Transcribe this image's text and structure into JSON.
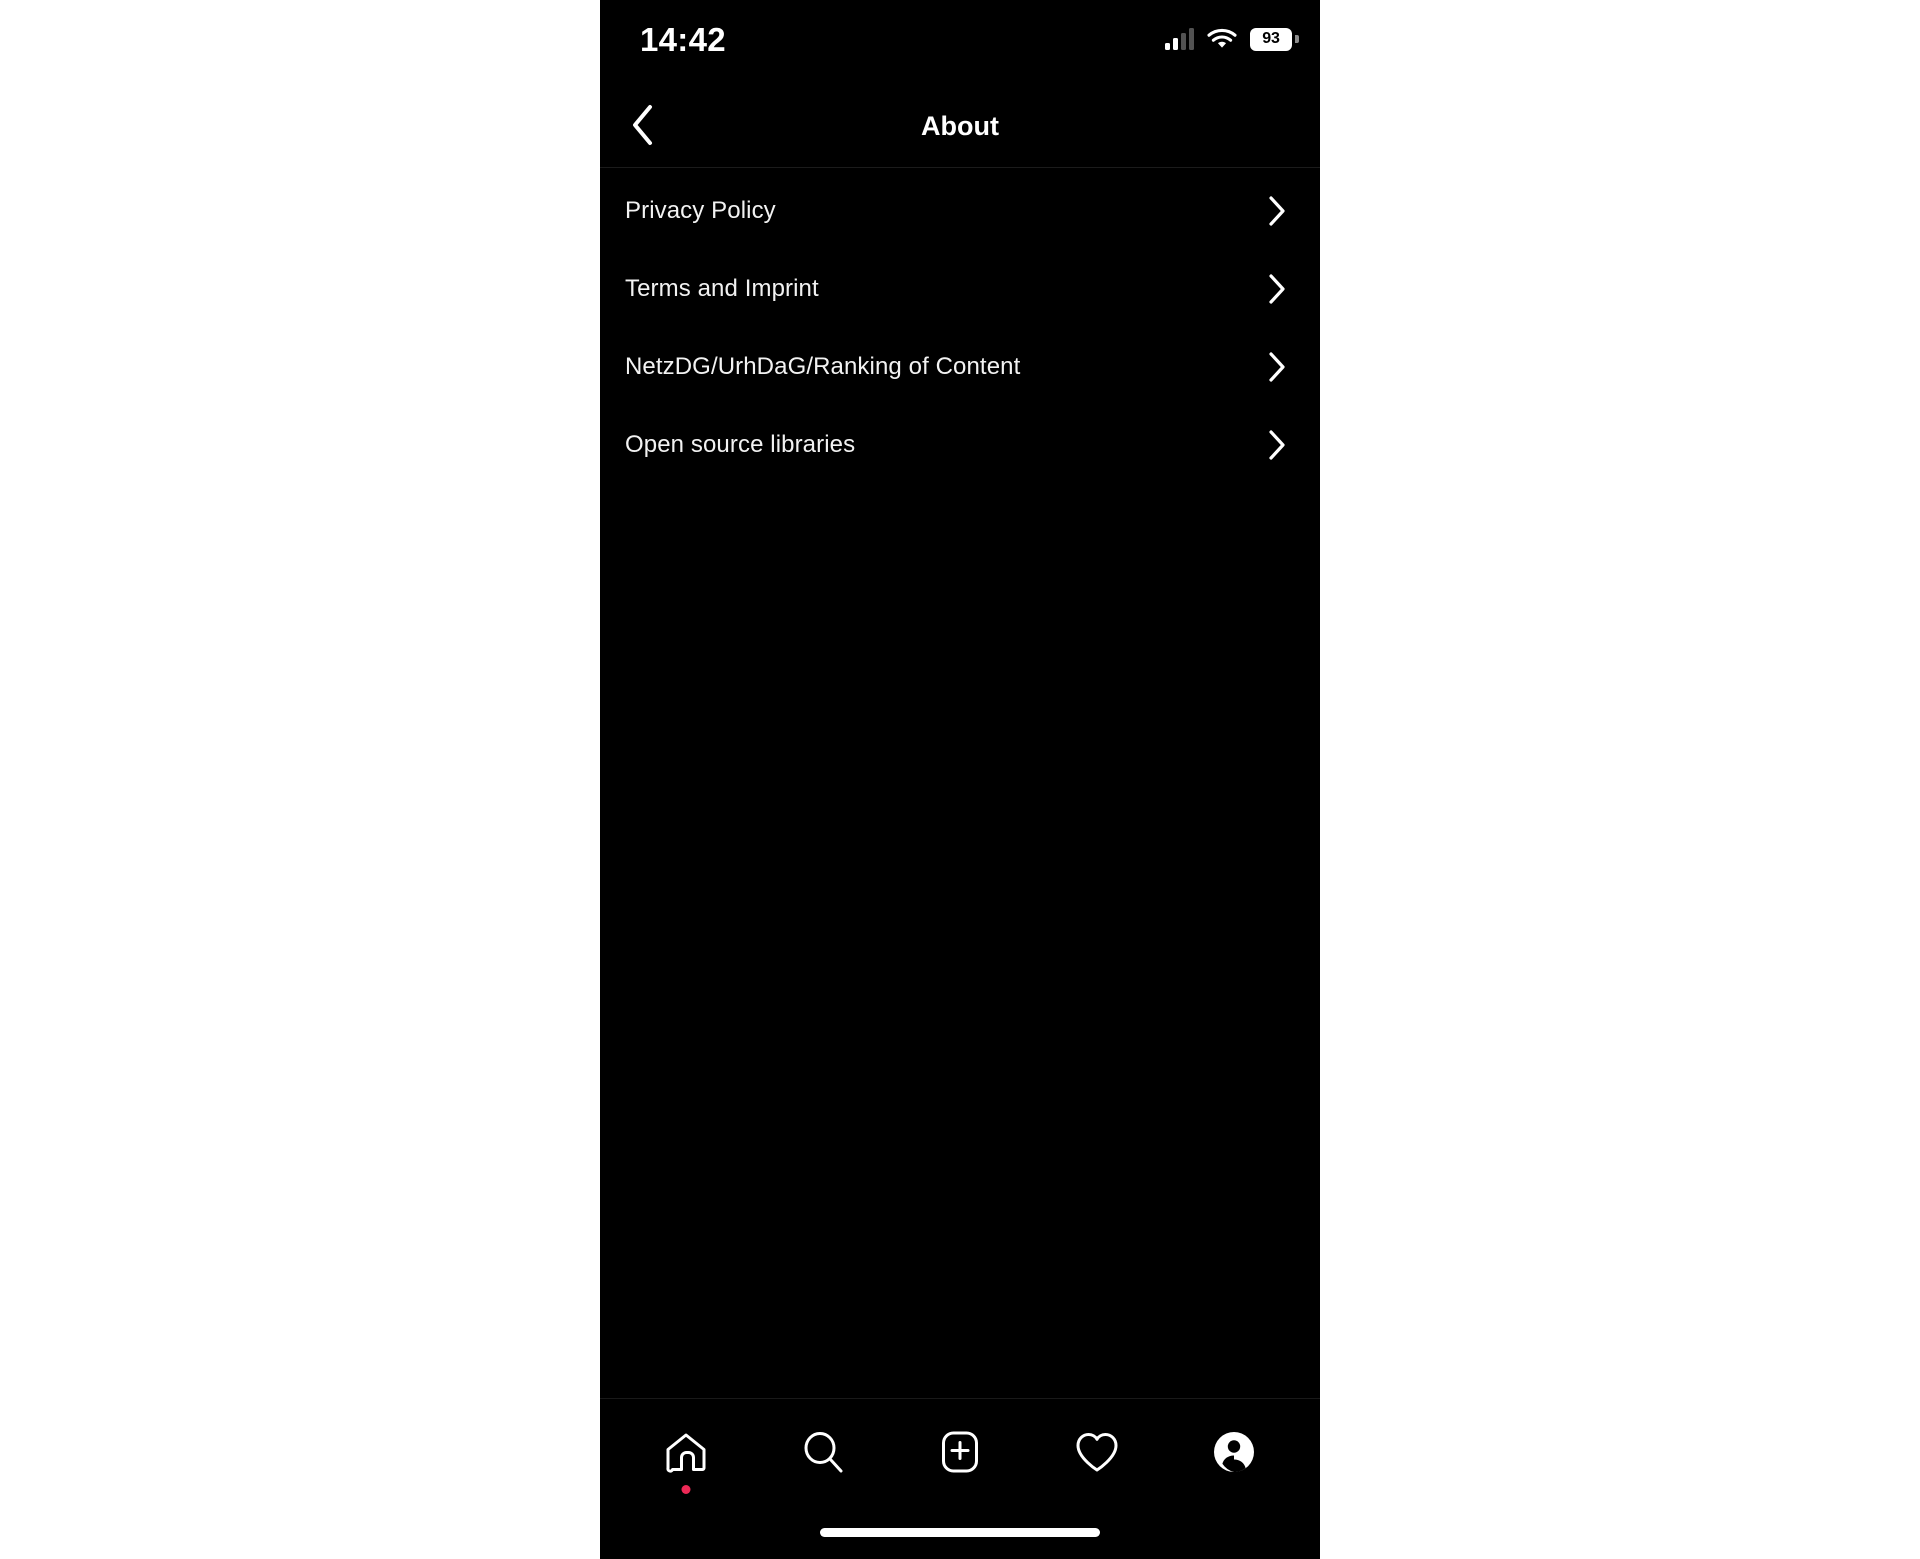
{
  "status_bar": {
    "time": "14:42",
    "battery_level": "93",
    "cellular_icon": "cellular-bars-icon",
    "wifi_icon": "wifi-icon",
    "battery_icon": "battery-icon"
  },
  "nav": {
    "title": "About",
    "back_icon": "chevron-left-icon"
  },
  "list": {
    "rows": [
      {
        "label": "Privacy Policy",
        "chevron": "chevron-right-icon"
      },
      {
        "label": "Terms and Imprint",
        "chevron": "chevron-right-icon"
      },
      {
        "label": "NetzDG/UrhDaG/Ranking of Content",
        "chevron": "chevron-right-icon"
      },
      {
        "label": "Open source libraries",
        "chevron": "chevron-right-icon"
      }
    ]
  },
  "tab_bar": {
    "items": [
      {
        "name": "home",
        "icon": "home-icon",
        "badge": true
      },
      {
        "name": "search",
        "icon": "search-icon",
        "badge": false
      },
      {
        "name": "create",
        "icon": "plus-square-icon",
        "badge": false
      },
      {
        "name": "activity",
        "icon": "heart-icon",
        "badge": false
      },
      {
        "name": "profile",
        "icon": "profile-avatar-icon",
        "badge": false
      }
    ],
    "badge_color": "#ed2956"
  },
  "colors": {
    "background": "#000000",
    "text": "#f2f2f2",
    "accent": "#ed2956",
    "separator": "#1b1b1b"
  }
}
